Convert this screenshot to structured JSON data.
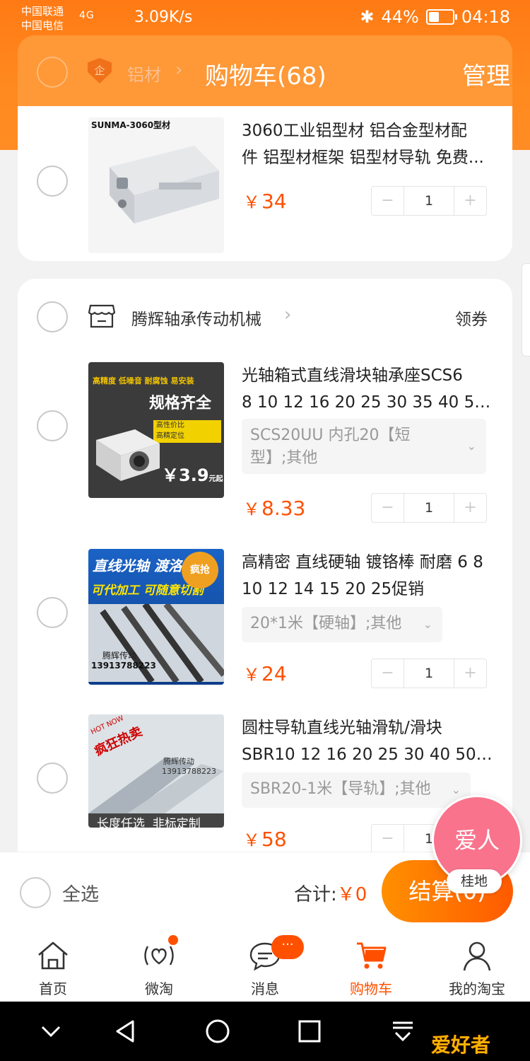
{
  "status": {
    "carrier1": "中国联通",
    "carrier2": "中国电信",
    "network": "4G",
    "speed": "3.09K/s",
    "battery": "44%",
    "time": "04:18"
  },
  "header": {
    "shop_tag": "企",
    "shop_label": "铝材",
    "title": "购物车(68)",
    "manage": "管理"
  },
  "items_first_shop": [
    {
      "thumb_label": "SUNMA-3060型材",
      "title_line1": "3060工业铝型材 铝合金型材配",
      "title_line2": "件 铝型材框架 铝型材导轨 免费...",
      "price_symbol": "￥",
      "price": "34",
      "qty": "1"
    }
  ],
  "shop2": {
    "name": "腾辉轴承传动机械",
    "coupon": "领券",
    "items": [
      {
        "thumb_top": "高精度 低噪音 耐腐蚀 易安装",
        "thumb_big": "规格齐全",
        "thumb_b1": "高性价比",
        "thumb_b2": "高精定位",
        "thumb_price": "￥3.9",
        "thumb_unit": "元起",
        "title_line1": "光轴箱式直线滑块轴承座SCS6",
        "title_line2": "8 10 12 16 20 25 30 35 40 50 6...",
        "sku_line1": "SCS20UU 内孔20【短",
        "sku_line2": "型】;其他",
        "price_symbol": "￥",
        "price": "8.33",
        "qty": "1"
      },
      {
        "thumb_l1": "直线光轴 渡洛",
        "thumb_l2": "可代加工 可随意切割",
        "thumb_badge": "疯抢",
        "thumb_shop": "腾辉传动",
        "thumb_phone": "13913788223",
        "title_line1": "高精密 直线硬轴 镀铬棒 耐磨 6 8",
        "title_line2": "10 12 14 15 20 25促销",
        "sku": "20*1米【硬轴】;其他",
        "price_symbol": "￥",
        "price": "24",
        "qty": "1"
      },
      {
        "thumb_hot": "HOT NOW",
        "thumb_ribbon": "疯狂热卖",
        "thumb_shop": "腾辉传动",
        "thumb_phone": "13913788223",
        "thumb_bottom": "长度任选  非标定制",
        "title_line1": "圆柱导轨直线光轴滑轨/滑块",
        "title_line2": "SBR10 12 16 20 25 30 40 50光...",
        "sku": "SBR20-1米【导轨】;其他",
        "price_symbol": "￥",
        "price": "58",
        "qty": "1"
      }
    ]
  },
  "footer": {
    "select_all": "全选",
    "total_label": "合计:",
    "total_amount": "￥0",
    "checkout": "结算(0)"
  },
  "floating": {
    "bubble": "爱人",
    "tag": "桂地"
  },
  "tabs": [
    {
      "label": "首页",
      "icon": "home-icon"
    },
    {
      "label": "微淘",
      "icon": "weitao-icon"
    },
    {
      "label": "消息",
      "icon": "message-icon",
      "badge": "···"
    },
    {
      "label": "购物车",
      "icon": "cart-icon"
    },
    {
      "label": "我的淘宝",
      "icon": "profile-icon"
    }
  ],
  "watermark": "爱好者",
  "colors": {
    "accent": "#ff5000",
    "header": "#ff7a14",
    "bubble": "#f9738c"
  }
}
